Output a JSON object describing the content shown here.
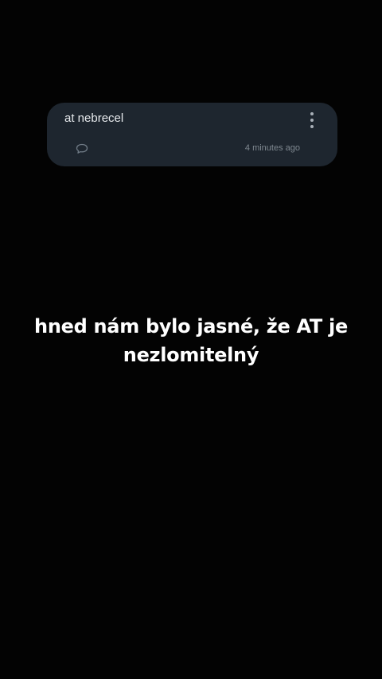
{
  "comment": {
    "text": "at nebrecel",
    "timestamp": "4 minutes ago",
    "reply_icon": "speech-bubble-icon",
    "menu_icon": "more-vertical-icon"
  },
  "caption": {
    "text": "hned nám bylo jasné, že AT je nezlomitelný"
  },
  "colors": {
    "background": "#030303",
    "card": "#1e262f",
    "caption_text": "#ffffff"
  }
}
